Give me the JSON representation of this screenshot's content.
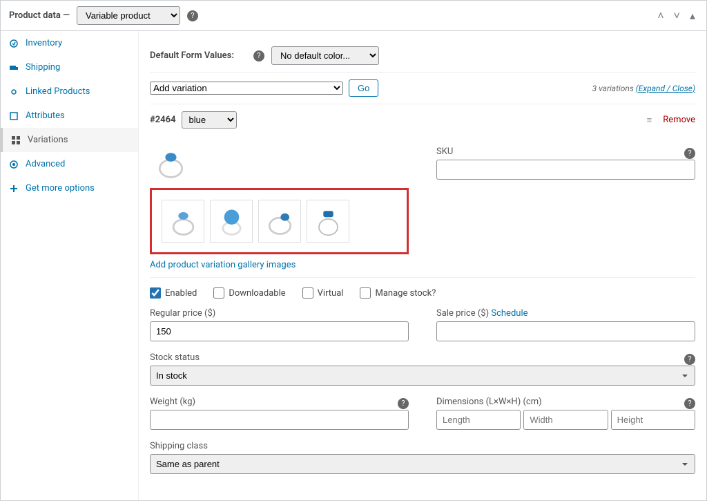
{
  "header": {
    "title": "Product data —",
    "product_type": "Variable product"
  },
  "sidebar": {
    "items": [
      {
        "label": "Inventory",
        "icon": "inventory"
      },
      {
        "label": "Shipping",
        "icon": "shipping"
      },
      {
        "label": "Linked Products",
        "icon": "linked"
      },
      {
        "label": "Attributes",
        "icon": "attributes"
      },
      {
        "label": "Variations",
        "icon": "variations",
        "active": true
      },
      {
        "label": "Advanced",
        "icon": "advanced"
      },
      {
        "label": "Get more options",
        "icon": "more"
      }
    ]
  },
  "main": {
    "default_values_label": "Default Form Values:",
    "default_color": "No default color...",
    "add_variation": "Add variation",
    "go_label": "Go",
    "variations_count": "3 variations",
    "expand_close": "(Expand / Close)",
    "variation": {
      "id": "#2464",
      "color": "blue",
      "remove": "Remove",
      "sku_label": "SKU",
      "sku_value": "",
      "add_gallery": "Add product variation gallery images",
      "checkboxes": {
        "enabled": "Enabled",
        "downloadable": "Downloadable",
        "virtual": "Virtual",
        "manage_stock": "Manage stock?"
      },
      "regular_price_label": "Regular price ($)",
      "regular_price": "150",
      "sale_price_label": "Sale price ($) ",
      "schedule": "Schedule",
      "sale_price": "",
      "stock_status_label": "Stock status",
      "stock_status": "In stock",
      "weight_label": "Weight (kg)",
      "weight": "",
      "dimensions_label": "Dimensions (L×W×H) (cm)",
      "length_ph": "Length",
      "width_ph": "Width",
      "height_ph": "Height",
      "shipping_class_label": "Shipping class",
      "shipping_class": "Same as parent"
    }
  }
}
